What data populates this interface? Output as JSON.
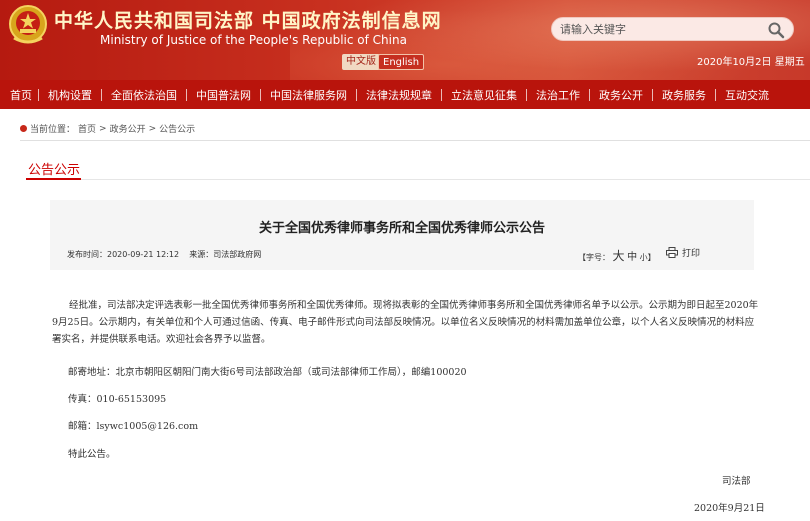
{
  "header": {
    "title_cn": "中华人民共和国司法部  中国政府法制信息网",
    "title_en": "Ministry of Justice of the People's Republic of China",
    "lang_cn": "中文版",
    "lang_en": "English",
    "search_placeholder": "请输入关键字",
    "date": "2020年10月2日  星期五"
  },
  "nav": [
    "首页",
    "机构设置",
    "全面依法治国",
    "中国普法网",
    "中国法律服务网",
    "法律法规规章",
    "立法意见征集",
    "法治工作",
    "政务公开",
    "政务服务",
    "互动交流"
  ],
  "breadcrumb": {
    "prefix": "当前位置：",
    "items": [
      "首页",
      "政务公开",
      "公告公示"
    ],
    "sep": ">"
  },
  "section_title": "公告公示",
  "article": {
    "title": "关于全国优秀律师事务所和全国优秀律师公示公告",
    "publish_label": "发布时间：",
    "publish_time": "2020-09-21 12:12",
    "source_label": "来源：",
    "source": "司法部政府网",
    "font_label": "【字号：",
    "font_big": "大",
    "font_mid": "中",
    "font_small": "小",
    "font_close": "】",
    "print": "打印",
    "paragraph": "经批准，司法部决定评选表彰一批全国优秀律师事务所和全国优秀律师。现将拟表彰的全国优秀律师事务所和全国优秀律师名单予以公示。公示期为即日起至2020年9月25日。公示期内，有关单位和个人可通过信函、传真、电子邮件形式向司法部反映情况。以单位名义反映情况的材料需加盖单位公章，以个人名义反映情况的材料应署实名，并提供联系电话。欢迎社会各界予以监督。",
    "address": "邮寄地址：北京市朝阳区朝阳门南大街6号司法部政治部（或司法部律师工作局），邮编100020",
    "fax": "传真：010-65153095",
    "email": "邮箱：lsywc1005@126.com",
    "closing": "特此公告。",
    "signer": "司法部",
    "sign_date": "2020年9月21日"
  },
  "colors": {
    "header_red": "#c8301f",
    "nav_red": "#b9140c",
    "accent_red": "#cc0000"
  }
}
